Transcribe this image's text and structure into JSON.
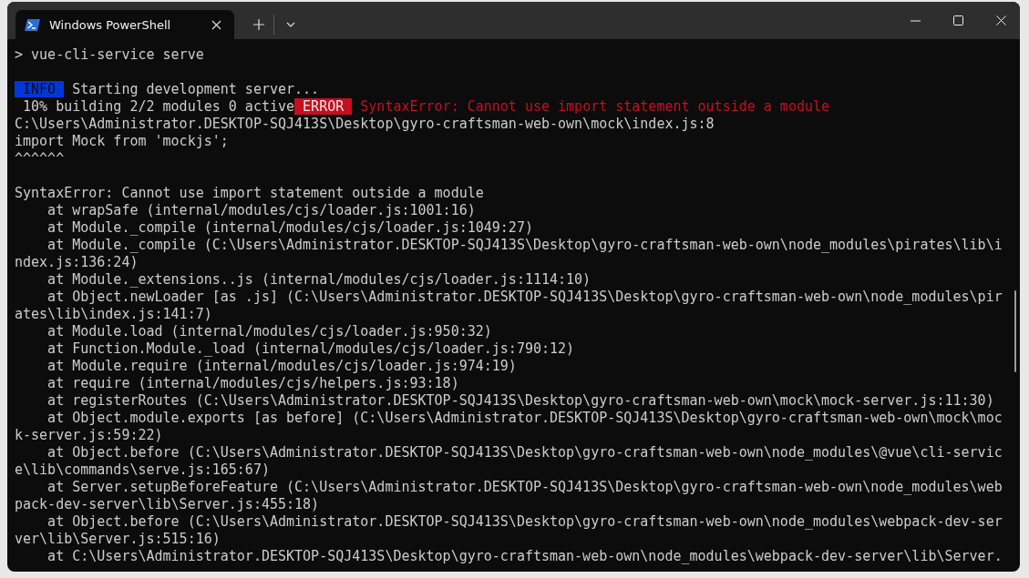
{
  "window": {
    "tab": {
      "title": "Windows PowerShell",
      "selected": true
    }
  },
  "terminal": {
    "lines": [
      {
        "kind": "text",
        "segments": [
          {
            "kind": "plain",
            "text": "> vue-cli-service serve"
          }
        ]
      },
      {
        "kind": "blank"
      },
      {
        "kind": "text",
        "segments": [
          {
            "kind": "info_badge",
            "text": " INFO "
          },
          {
            "kind": "plain",
            "text": " Starting development server..."
          }
        ]
      },
      {
        "kind": "text",
        "segments": [
          {
            "kind": "plain",
            "text": " 10% building 2/2 modules 0 active"
          },
          {
            "kind": "error_badge",
            "text": " ERROR "
          },
          {
            "kind": "error",
            "text": " SyntaxError: Cannot use import statement outside a module"
          }
        ]
      },
      {
        "kind": "text",
        "segments": [
          {
            "kind": "plain",
            "text": "C:\\Users\\Administrator.DESKTOP-SQJ413S\\Desktop\\gyro-craftsman-web-own\\mock\\index.js:8"
          }
        ]
      },
      {
        "kind": "text",
        "segments": [
          {
            "kind": "plain",
            "text": "import Mock from 'mockjs';"
          }
        ]
      },
      {
        "kind": "text",
        "segments": [
          {
            "kind": "plain",
            "text": "^^^^^^"
          }
        ]
      },
      {
        "kind": "blank"
      },
      {
        "kind": "text",
        "segments": [
          {
            "kind": "plain",
            "text": "SyntaxError: Cannot use import statement outside a module"
          }
        ]
      },
      {
        "kind": "text",
        "segments": [
          {
            "kind": "plain",
            "text": "    at wrapSafe (internal/modules/cjs/loader.js:1001:16)"
          }
        ]
      },
      {
        "kind": "text",
        "segments": [
          {
            "kind": "plain",
            "text": "    at Module._compile (internal/modules/cjs/loader.js:1049:27)"
          }
        ]
      },
      {
        "kind": "text",
        "segments": [
          {
            "kind": "plain",
            "text": "    at Module._compile (C:\\Users\\Administrator.DESKTOP-SQJ413S\\Desktop\\gyro-craftsman-web-own\\node_modules\\pirates\\lib\\i"
          }
        ]
      },
      {
        "kind": "text",
        "segments": [
          {
            "kind": "plain",
            "text": "ndex.js:136:24)"
          }
        ]
      },
      {
        "kind": "text",
        "segments": [
          {
            "kind": "plain",
            "text": "    at Module._extensions..js (internal/modules/cjs/loader.js:1114:10)"
          }
        ]
      },
      {
        "kind": "text",
        "segments": [
          {
            "kind": "plain",
            "text": "    at Object.newLoader [as .js] (C:\\Users\\Administrator.DESKTOP-SQJ413S\\Desktop\\gyro-craftsman-web-own\\node_modules\\pir"
          }
        ]
      },
      {
        "kind": "text",
        "segments": [
          {
            "kind": "plain",
            "text": "ates\\lib\\index.js:141:7)"
          }
        ]
      },
      {
        "kind": "text",
        "segments": [
          {
            "kind": "plain",
            "text": "    at Module.load (internal/modules/cjs/loader.js:950:32)"
          }
        ]
      },
      {
        "kind": "text",
        "segments": [
          {
            "kind": "plain",
            "text": "    at Function.Module._load (internal/modules/cjs/loader.js:790:12)"
          }
        ]
      },
      {
        "kind": "text",
        "segments": [
          {
            "kind": "plain",
            "text": "    at Module.require (internal/modules/cjs/loader.js:974:19)"
          }
        ]
      },
      {
        "kind": "text",
        "segments": [
          {
            "kind": "plain",
            "text": "    at require (internal/modules/cjs/helpers.js:93:18)"
          }
        ]
      },
      {
        "kind": "text",
        "segments": [
          {
            "kind": "plain",
            "text": "    at registerRoutes (C:\\Users\\Administrator.DESKTOP-SQJ413S\\Desktop\\gyro-craftsman-web-own\\mock\\mock-server.js:11:30)"
          }
        ]
      },
      {
        "kind": "text",
        "segments": [
          {
            "kind": "plain",
            "text": "    at Object.module.exports [as before] (C:\\Users\\Administrator.DESKTOP-SQJ413S\\Desktop\\gyro-craftsman-web-own\\mock\\moc"
          }
        ]
      },
      {
        "kind": "text",
        "segments": [
          {
            "kind": "plain",
            "text": "k-server.js:59:22)"
          }
        ]
      },
      {
        "kind": "text",
        "segments": [
          {
            "kind": "plain",
            "text": "    at Object.before (C:\\Users\\Administrator.DESKTOP-SQJ413S\\Desktop\\gyro-craftsman-web-own\\node_modules\\@vue\\cli-servic"
          }
        ]
      },
      {
        "kind": "text",
        "segments": [
          {
            "kind": "plain",
            "text": "e\\lib\\commands\\serve.js:165:67)"
          }
        ]
      },
      {
        "kind": "text",
        "segments": [
          {
            "kind": "plain",
            "text": "    at Server.setupBeforeFeature (C:\\Users\\Administrator.DESKTOP-SQJ413S\\Desktop\\gyro-craftsman-web-own\\node_modules\\web"
          }
        ]
      },
      {
        "kind": "text",
        "segments": [
          {
            "kind": "plain",
            "text": "pack-dev-server\\lib\\Server.js:455:18)"
          }
        ]
      },
      {
        "kind": "text",
        "segments": [
          {
            "kind": "plain",
            "text": "    at Object.before (C:\\Users\\Administrator.DESKTOP-SQJ413S\\Desktop\\gyro-craftsman-web-own\\node_modules\\webpack-dev-ser"
          }
        ]
      },
      {
        "kind": "text",
        "segments": [
          {
            "kind": "plain",
            "text": "ver\\lib\\Server.js:515:16)"
          }
        ]
      },
      {
        "kind": "text",
        "segments": [
          {
            "kind": "plain",
            "text": "    at C:\\Users\\Administrator.DESKTOP-SQJ413S\\Desktop\\gyro-craftsman-web-own\\node_modules\\webpack-dev-server\\lib\\Server."
          }
        ]
      }
    ]
  }
}
